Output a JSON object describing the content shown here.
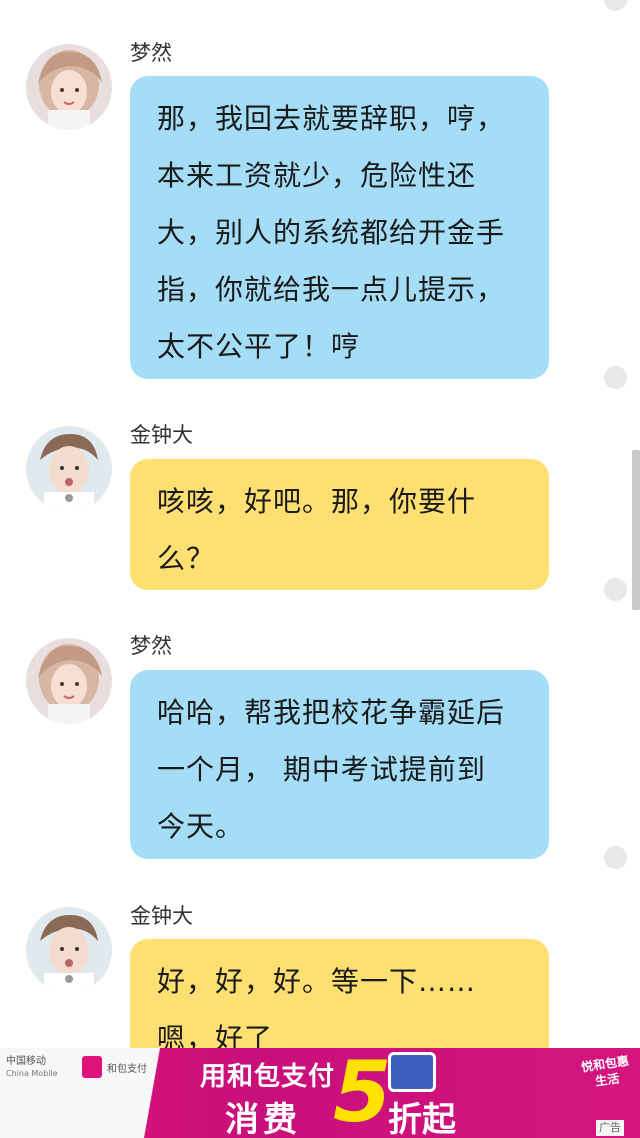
{
  "messages": [
    {
      "sender": "梦然",
      "side": "left",
      "bubble_color": "#a5ddf7",
      "lines": [
        "那，我回去就要辞职，哼，",
        "本来工资就少，危险性还",
        "大，别人的系统都给开金手",
        "指，你就给我一点儿提示，",
        "太不公平了！哼"
      ]
    },
    {
      "sender": "金钟大",
      "side": "left",
      "bubble_color": "#fedf72",
      "lines": [
        "咳咳，好吧。那，你要什",
        "么？"
      ]
    },
    {
      "sender": "梦然",
      "side": "left",
      "bubble_color": "#a5ddf7",
      "lines": [
        "哈哈，帮我把校花争霸延后",
        "一个月， 期中考试提前到",
        "今天。"
      ]
    },
    {
      "sender": "金钟大",
      "side": "left",
      "bubble_color": "#fedf72",
      "lines": [
        "好，好，好。等一下……",
        "嗯，好了"
      ]
    }
  ],
  "ad": {
    "carrier": "中国移动",
    "carrier_en": "China Mobile",
    "partner": "和包支付",
    "headline": "用和包支付",
    "subline_left": "消费",
    "discount_number": "5",
    "subline_right": "折起",
    "badge": "悦和包惠生活",
    "label": "广告"
  }
}
